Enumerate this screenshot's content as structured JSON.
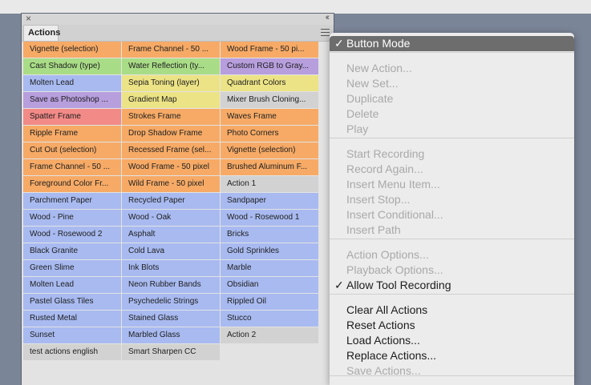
{
  "panel": {
    "close_glyph": "×",
    "collapse_glyph": "‹‹",
    "tab_label": "Actions",
    "buttons": [
      {
        "label": "Vignette (selection)",
        "color": "orange"
      },
      {
        "label": "Frame Channel - 50 ...",
        "color": "orange"
      },
      {
        "label": "Wood Frame - 50 pi...",
        "color": "orange"
      },
      {
        "label": "Cast Shadow (type)",
        "color": "green"
      },
      {
        "label": "Water Reflection (ty...",
        "color": "green"
      },
      {
        "label": "Custom RGB to Gray...",
        "color": "violet"
      },
      {
        "label": "Molten Lead",
        "color": "blue"
      },
      {
        "label": "Sepia Toning (layer)",
        "color": "yellow"
      },
      {
        "label": "Quadrant Colors",
        "color": "yellow"
      },
      {
        "label": "Save as Photoshop ...",
        "color": "violet"
      },
      {
        "label": "Gradient Map",
        "color": "yellow"
      },
      {
        "label": "Mixer Brush Cloning...",
        "color": "gray"
      },
      {
        "label": "Spatter Frame",
        "color": "red"
      },
      {
        "label": "Strokes Frame",
        "color": "orange"
      },
      {
        "label": "Waves Frame",
        "color": "orange"
      },
      {
        "label": "Ripple Frame",
        "color": "orange"
      },
      {
        "label": "Drop Shadow Frame",
        "color": "orange"
      },
      {
        "label": "Photo Corners",
        "color": "orange"
      },
      {
        "label": "Cut Out (selection)",
        "color": "orange"
      },
      {
        "label": "Recessed Frame (sel...",
        "color": "orange"
      },
      {
        "label": "Vignette (selection)",
        "color": "orange"
      },
      {
        "label": "Frame Channel - 50 ...",
        "color": "orange"
      },
      {
        "label": "Wood Frame - 50 pixel",
        "color": "orange"
      },
      {
        "label": "Brushed Aluminum F...",
        "color": "orange"
      },
      {
        "label": "Foreground Color Fr...",
        "color": "orange"
      },
      {
        "label": "Wild Frame - 50 pixel",
        "color": "orange"
      },
      {
        "label": "Action 1",
        "color": "gray"
      },
      {
        "label": "Parchment Paper",
        "color": "blue"
      },
      {
        "label": "Recycled Paper",
        "color": "blue"
      },
      {
        "label": "Sandpaper",
        "color": "blue"
      },
      {
        "label": "Wood - Pine",
        "color": "blue"
      },
      {
        "label": "Wood - Oak",
        "color": "blue"
      },
      {
        "label": "Wood - Rosewood 1",
        "color": "blue"
      },
      {
        "label": "Wood - Rosewood 2",
        "color": "blue"
      },
      {
        "label": "Asphalt",
        "color": "blue"
      },
      {
        "label": "Bricks",
        "color": "blue"
      },
      {
        "label": "Black Granite",
        "color": "blue"
      },
      {
        "label": "Cold Lava",
        "color": "blue"
      },
      {
        "label": "Gold Sprinkles",
        "color": "blue"
      },
      {
        "label": "Green Slime",
        "color": "blue"
      },
      {
        "label": "Ink Blots",
        "color": "blue"
      },
      {
        "label": "Marble",
        "color": "blue"
      },
      {
        "label": "Molten Lead",
        "color": "blue"
      },
      {
        "label": "Neon Rubber Bands",
        "color": "blue"
      },
      {
        "label": "Obsidian",
        "color": "blue"
      },
      {
        "label": "Pastel Glass Tiles",
        "color": "blue"
      },
      {
        "label": "Psychedelic Strings",
        "color": "blue"
      },
      {
        "label": "Rippled Oil",
        "color": "blue"
      },
      {
        "label": "Rusted Metal",
        "color": "blue"
      },
      {
        "label": "Stained Glass",
        "color": "blue"
      },
      {
        "label": "Stucco",
        "color": "blue"
      },
      {
        "label": "Sunset",
        "color": "blue"
      },
      {
        "label": "Marbled Glass",
        "color": "blue"
      },
      {
        "label": "Action 2",
        "color": "gray"
      },
      {
        "label": "test actions english",
        "color": "gray"
      },
      {
        "label": "Smart Sharpen CC",
        "color": "gray"
      }
    ]
  },
  "menu": {
    "check_glyph": "✓",
    "items": [
      {
        "label": "Button Mode",
        "checked": true,
        "disabled": false,
        "highlight": true
      },
      {
        "label": "New Action...",
        "disabled": true
      },
      {
        "label": "New Set...",
        "disabled": true
      },
      {
        "label": "Duplicate",
        "disabled": true
      },
      {
        "label": "Delete",
        "disabled": true
      },
      {
        "label": "Play",
        "disabled": true
      },
      {
        "label": "Start Recording",
        "disabled": true
      },
      {
        "label": "Record Again...",
        "disabled": true
      },
      {
        "label": "Insert Menu Item...",
        "disabled": true
      },
      {
        "label": "Insert Stop...",
        "disabled": true
      },
      {
        "label": "Insert Conditional...",
        "disabled": true
      },
      {
        "label": "Insert Path",
        "disabled": true
      },
      {
        "label": "Action Options...",
        "disabled": true
      },
      {
        "label": "Playback Options...",
        "disabled": true
      },
      {
        "label": "Allow Tool Recording",
        "checked": true,
        "disabled": false
      },
      {
        "label": "Clear All Actions",
        "disabled": false
      },
      {
        "label": "Reset Actions",
        "disabled": false
      },
      {
        "label": "Load Actions...",
        "disabled": false
      },
      {
        "label": "Replace Actions...",
        "disabled": false
      },
      {
        "label": "Save Actions...",
        "disabled": true
      }
    ]
  },
  "colors": {
    "orange": "#f6aa66",
    "green": "#a9dc87",
    "violet": "#b79edd",
    "blue": "#a8baf0",
    "yellow": "#ece386",
    "gray": "#d2d2d2",
    "red": "#f28a87",
    "menu_highlight": "#6d6d6d"
  }
}
